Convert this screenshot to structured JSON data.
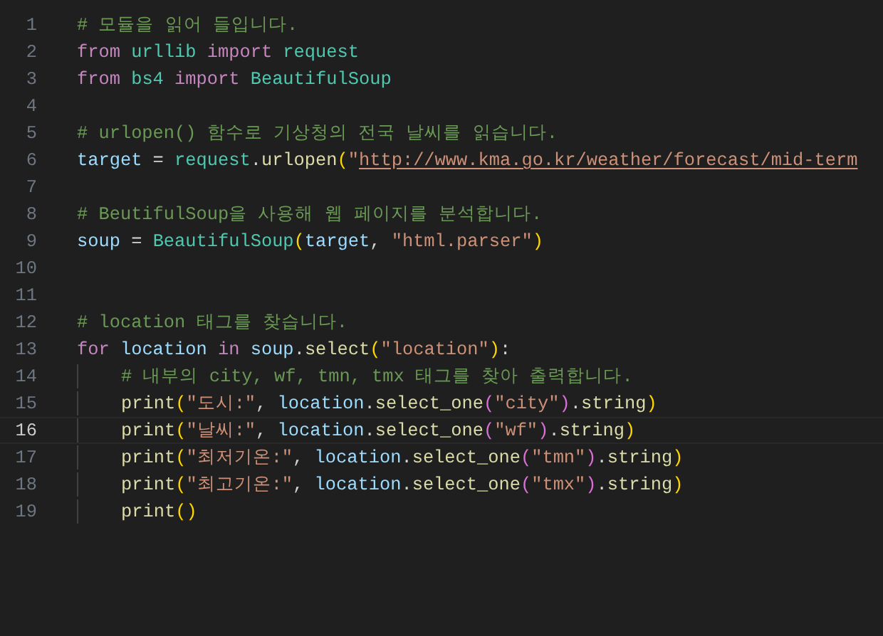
{
  "editor": {
    "lines": [
      {
        "number": "1",
        "current": false,
        "tokens": [
          {
            "kind": "comment",
            "text": "# 모듈을 읽어 들입니다."
          }
        ]
      },
      {
        "number": "2",
        "current": false,
        "tokens": [
          {
            "kind": "keyword",
            "text": "from "
          },
          {
            "kind": "module",
            "text": "urllib "
          },
          {
            "kind": "keyword",
            "text": "import "
          },
          {
            "kind": "module",
            "text": "request"
          }
        ]
      },
      {
        "number": "3",
        "current": false,
        "tokens": [
          {
            "kind": "keyword",
            "text": "from "
          },
          {
            "kind": "module",
            "text": "bs4 "
          },
          {
            "kind": "keyword",
            "text": "import "
          },
          {
            "kind": "module",
            "text": "BeautifulSoup"
          }
        ]
      },
      {
        "number": "4",
        "current": false
      },
      {
        "number": "5",
        "current": false,
        "tokens": [
          {
            "kind": "comment",
            "text": "# urlopen() 함수로 기상청의 전국 날씨를 읽습니다."
          }
        ]
      },
      {
        "number": "6",
        "current": false,
        "tokens": [
          {
            "kind": "variable",
            "text": "target"
          },
          {
            "kind": "plain",
            "text": " = "
          },
          {
            "kind": "module",
            "text": "request"
          },
          {
            "kind": "plain",
            "text": "."
          },
          {
            "kind": "function",
            "text": "urlopen"
          },
          {
            "kind": "bracket",
            "text": "("
          },
          {
            "kind": "string",
            "text": "\""
          },
          {
            "kind": "link",
            "text": "http://www.kma.go.kr/weather/forecast/mid-term"
          }
        ]
      },
      {
        "number": "7",
        "current": false
      },
      {
        "number": "8",
        "current": false,
        "tokens": [
          {
            "kind": "comment",
            "text": "# BeutifulSoup을 사용해 웹 페이지를 분석합니다."
          }
        ]
      },
      {
        "number": "9",
        "current": false,
        "tokens": [
          {
            "kind": "variable",
            "text": "soup"
          },
          {
            "kind": "plain",
            "text": " = "
          },
          {
            "kind": "module",
            "text": "BeautifulSoup"
          },
          {
            "kind": "bracket",
            "text": "("
          },
          {
            "kind": "variable",
            "text": "target"
          },
          {
            "kind": "plain",
            "text": ", "
          },
          {
            "kind": "string",
            "text": "\"html.parser\""
          },
          {
            "kind": "bracket",
            "text": ")"
          }
        ]
      },
      {
        "number": "10",
        "current": false
      },
      {
        "number": "11",
        "current": false
      },
      {
        "number": "12",
        "current": false,
        "tokens": [
          {
            "kind": "comment",
            "text": "# location 태그를 찾습니다."
          }
        ]
      },
      {
        "number": "13",
        "current": false,
        "tokens": [
          {
            "kind": "keyword",
            "text": "for "
          },
          {
            "kind": "variable",
            "text": "location "
          },
          {
            "kind": "keyword",
            "text": "in "
          },
          {
            "kind": "variable",
            "text": "soup"
          },
          {
            "kind": "plain",
            "text": "."
          },
          {
            "kind": "function",
            "text": "select"
          },
          {
            "kind": "bracket",
            "text": "("
          },
          {
            "kind": "string",
            "text": "\"location\""
          },
          {
            "kind": "bracket",
            "text": ")"
          },
          {
            "kind": "plain",
            "text": ":"
          }
        ],
        "children": [
          {
            "number": "14",
            "current": false,
            "tokens": [
              {
                "kind": "comment",
                "text": "# 내부의 city, wf, tmn, tmx 태그를 찾아 출력합니다."
              }
            ]
          },
          {
            "number": "15",
            "current": false,
            "tokens": [
              {
                "kind": "function",
                "text": "print"
              },
              {
                "kind": "bracket",
                "text": "("
              },
              {
                "kind": "string",
                "text": "\"도시:\""
              },
              {
                "kind": "plain",
                "text": ", "
              },
              {
                "kind": "variable",
                "text": "location"
              },
              {
                "kind": "plain",
                "text": "."
              },
              {
                "kind": "function",
                "text": "select_one"
              },
              {
                "kind": "bracket2",
                "text": "("
              },
              {
                "kind": "string",
                "text": "\"city\""
              },
              {
                "kind": "bracket2",
                "text": ")"
              },
              {
                "kind": "plain",
                "text": "."
              },
              {
                "kind": "function",
                "text": "string"
              },
              {
                "kind": "bracket",
                "text": ")"
              }
            ]
          },
          {
            "number": "16",
            "current": true,
            "tokens": [
              {
                "kind": "function",
                "text": "print"
              },
              {
                "kind": "bracket",
                "text": "("
              },
              {
                "kind": "string",
                "text": "\"날씨:\""
              },
              {
                "kind": "plain",
                "text": ", "
              },
              {
                "kind": "variable",
                "text": "location"
              },
              {
                "kind": "plain",
                "text": "."
              },
              {
                "kind": "function",
                "text": "select_one"
              },
              {
                "kind": "bracket2",
                "text": "("
              },
              {
                "kind": "string",
                "text": "\"wf\""
              },
              {
                "kind": "bracket2",
                "text": ")"
              },
              {
                "kind": "plain",
                "text": "."
              },
              {
                "kind": "function",
                "text": "string"
              },
              {
                "kind": "bracket",
                "text": ")"
              }
            ]
          },
          {
            "number": "17",
            "current": false,
            "tokens": [
              {
                "kind": "function",
                "text": "print"
              },
              {
                "kind": "bracket",
                "text": "("
              },
              {
                "kind": "string",
                "text": "\"최저기온:\""
              },
              {
                "kind": "plain",
                "text": ", "
              },
              {
                "kind": "variable",
                "text": "location"
              },
              {
                "kind": "plain",
                "text": "."
              },
              {
                "kind": "function",
                "text": "select_one"
              },
              {
                "kind": "bracket2",
                "text": "("
              },
              {
                "kind": "string",
                "text": "\"tmn\""
              },
              {
                "kind": "bracket2",
                "text": ")"
              },
              {
                "kind": "plain",
                "text": "."
              },
              {
                "kind": "function",
                "text": "string"
              },
              {
                "kind": "bracket",
                "text": ")"
              }
            ]
          },
          {
            "number": "18",
            "current": false,
            "tokens": [
              {
                "kind": "function",
                "text": "print"
              },
              {
                "kind": "bracket",
                "text": "("
              },
              {
                "kind": "string",
                "text": "\"최고기온:\""
              },
              {
                "kind": "plain",
                "text": ", "
              },
              {
                "kind": "variable",
                "text": "location"
              },
              {
                "kind": "plain",
                "text": "."
              },
              {
                "kind": "function",
                "text": "select_one"
              },
              {
                "kind": "bracket2",
                "text": "("
              },
              {
                "kind": "string",
                "text": "\"tmx\""
              },
              {
                "kind": "bracket2",
                "text": ")"
              },
              {
                "kind": "plain",
                "text": "."
              },
              {
                "kind": "function",
                "text": "string"
              },
              {
                "kind": "bracket",
                "text": ")"
              }
            ]
          },
          {
            "number": "19",
            "current": false,
            "tokens": [
              {
                "kind": "function",
                "text": "print"
              },
              {
                "kind": "bracket",
                "text": "()"
              }
            ]
          }
        ]
      }
    ]
  }
}
